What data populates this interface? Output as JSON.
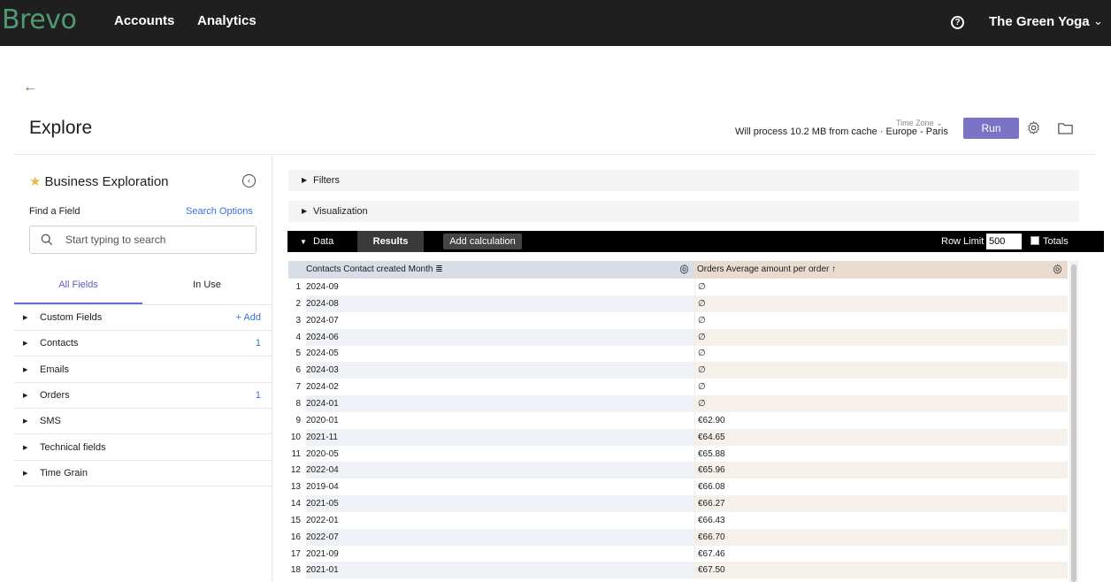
{
  "topbar": {
    "logo": "Brevo",
    "nav": [
      "Accounts",
      "Analytics"
    ],
    "help_icon": "question-circle-icon",
    "org_name": "The Green Yoga",
    "org_chevron": "⌄"
  },
  "header": {
    "back_icon": "←",
    "title": "Explore",
    "timezone_label": "Time Zone ⌄",
    "process_text": "Will process 10.2 MB from cache · Europe - Paris",
    "run_label": "Run",
    "run_color": "#7b74c6"
  },
  "sidebar": {
    "title": "Business Exploration",
    "star_icon": "★",
    "collapse_icon": "‹",
    "find_label": "Find a Field",
    "search_options": "Search Options",
    "search_placeholder": "Start typing to search",
    "tabs": [
      "All Fields",
      "In Use"
    ],
    "fields": [
      {
        "label": "Custom Fields",
        "extra": "+ Add",
        "type": "add"
      },
      {
        "label": "Contacts",
        "extra": "1",
        "type": "count"
      },
      {
        "label": "Emails",
        "extra": "",
        "type": "none"
      },
      {
        "label": "Orders",
        "extra": "1",
        "type": "count"
      },
      {
        "label": "SMS",
        "extra": "",
        "type": "none"
      },
      {
        "label": "Technical fields",
        "extra": "",
        "type": "none"
      },
      {
        "label": "Time Grain",
        "extra": "",
        "type": "none"
      }
    ]
  },
  "panels": {
    "filters": "Filters",
    "visualization": "Visualization"
  },
  "databar": {
    "data_label": "Data",
    "results_label": "Results",
    "add_calc_label": "Add calculation",
    "row_limit_label": "Row Limit",
    "row_limit_value": "500",
    "totals_label": "Totals"
  },
  "table": {
    "columns": [
      "Contacts Contact created Month",
      "Orders Average amount per order"
    ],
    "dim_suffix": "≣",
    "sort_indicator": "↑",
    "rows": [
      [
        "1",
        "2024-09",
        "∅"
      ],
      [
        "2",
        "2024-08",
        "∅"
      ],
      [
        "3",
        "2024-07",
        "∅"
      ],
      [
        "4",
        "2024-06",
        "∅"
      ],
      [
        "5",
        "2024-05",
        "∅"
      ],
      [
        "6",
        "2024-03",
        "∅"
      ],
      [
        "7",
        "2024-02",
        "∅"
      ],
      [
        "8",
        "2024-01",
        "∅"
      ],
      [
        "9",
        "2020-01",
        "€62.90"
      ],
      [
        "10",
        "2021-11",
        "€64.65"
      ],
      [
        "11",
        "2020-05",
        "€65.88"
      ],
      [
        "12",
        "2022-04",
        "€65.96"
      ],
      [
        "13",
        "2019-04",
        "€66.08"
      ],
      [
        "14",
        "2021-05",
        "€66.27"
      ],
      [
        "15",
        "2022-01",
        "€66.43"
      ],
      [
        "16",
        "2022-07",
        "€66.70"
      ],
      [
        "17",
        "2021-09",
        "€67.46"
      ],
      [
        "18",
        "2021-01",
        "€67.50"
      ]
    ]
  }
}
